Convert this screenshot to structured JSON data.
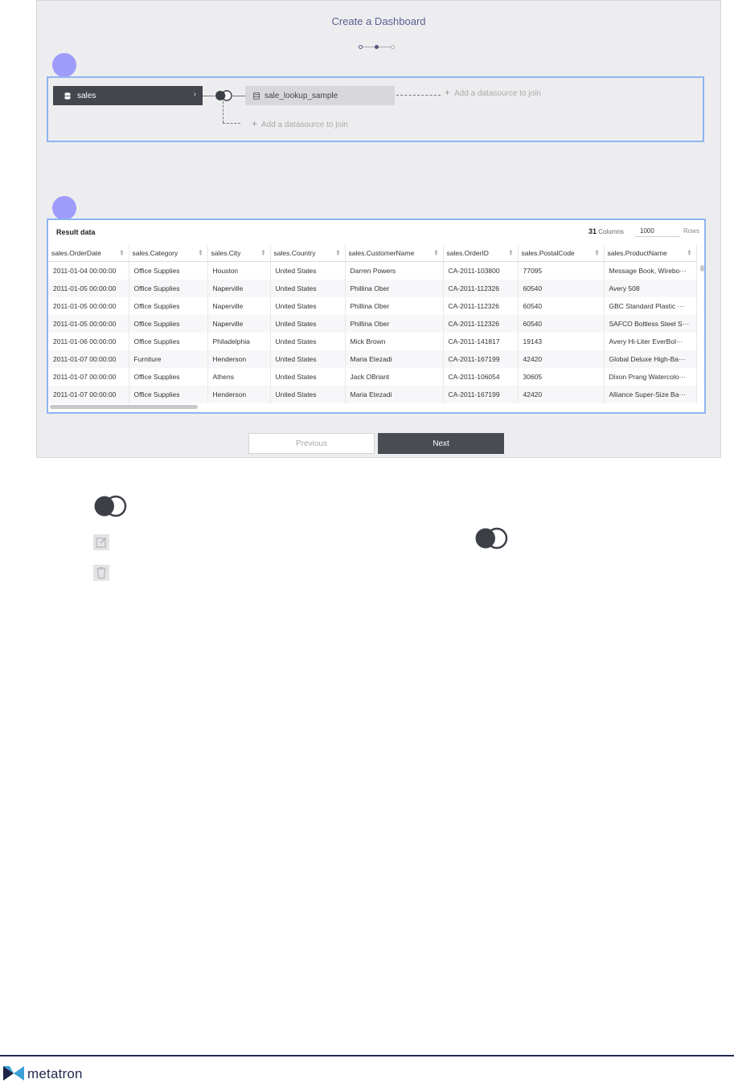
{
  "dialog": {
    "title": "Create a Dashboard"
  },
  "join": {
    "main_datasource": "sales",
    "joined_datasource": "sale_lookup_sample",
    "add_datasource_label": "Add a datasource to join"
  },
  "result": {
    "title": "Result data",
    "columns_count": "31",
    "columns_label": "Columns",
    "rows_value": "1000",
    "rows_label": "Rows",
    "headers": [
      "sales.OrderDate",
      "sales.Category",
      "sales.City",
      "sales.Country",
      "sales.CustomerName",
      "sales.OrderID",
      "sales.PostalCode",
      "sales.ProductName"
    ],
    "rows": [
      [
        "2011-01-04 00:00:00",
        "Office Supplies",
        "Houston",
        "United States",
        "Darren Powers",
        "CA-2011-103800",
        "77095",
        "Message Book, Wirebo···"
      ],
      [
        "2011-01-05 00:00:00",
        "Office Supplies",
        "Naperville",
        "United States",
        "Phillina Ober",
        "CA-2011-112326",
        "60540",
        "Avery 508"
      ],
      [
        "2011-01-05 00:00:00",
        "Office Supplies",
        "Naperville",
        "United States",
        "Phillina Ober",
        "CA-2011-112326",
        "60540",
        "GBC Standard Plastic ···"
      ],
      [
        "2011-01-05 00:00:00",
        "Office Supplies",
        "Naperville",
        "United States",
        "Phillina Ober",
        "CA-2011-112326",
        "60540",
        "SAFCO Boltless Steel S···"
      ],
      [
        "2011-01-06 00:00:00",
        "Office Supplies",
        "Philadelphia",
        "United States",
        "Mick Brown",
        "CA-2011-141817",
        "19143",
        "Avery Hi-Liter EverBol···"
      ],
      [
        "2011-01-07 00:00:00",
        "Furniture",
        "Henderson",
        "United States",
        "Maria Etezadi",
        "CA-2011-167199",
        "42420",
        "Global Deluxe High-Ba···"
      ],
      [
        "2011-01-07 00:00:00",
        "Office Supplies",
        "Athens",
        "United States",
        "Jack OBriant",
        "CA-2011-106054",
        "30605",
        "Dixon Prang Watercolo···"
      ],
      [
        "2011-01-07 00:00:00",
        "Office Supplies",
        "Henderson",
        "United States",
        "Maria Etezadi",
        "CA-2011-167199",
        "42420",
        "Alliance Super-Size Ba···"
      ]
    ]
  },
  "buttons": {
    "previous": "Previous",
    "next": "Next"
  },
  "footer": {
    "brand": "metatron"
  },
  "colors": {
    "accent": "#4f537d",
    "marker": "#9e9cfb",
    "highlight_border": "#8fb4f0",
    "brand": "#232a50"
  }
}
